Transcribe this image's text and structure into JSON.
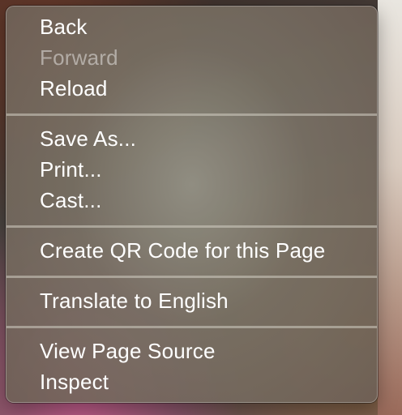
{
  "menu": {
    "groups": [
      {
        "items": [
          {
            "label": "Back",
            "enabled": true
          },
          {
            "label": "Forward",
            "enabled": false
          },
          {
            "label": "Reload",
            "enabled": true
          }
        ]
      },
      {
        "items": [
          {
            "label": "Save As...",
            "enabled": true
          },
          {
            "label": "Print...",
            "enabled": true
          },
          {
            "label": "Cast...",
            "enabled": true
          }
        ]
      },
      {
        "items": [
          {
            "label": "Create QR Code for this Page",
            "enabled": true
          }
        ]
      },
      {
        "items": [
          {
            "label": "Translate to English",
            "enabled": true
          }
        ]
      },
      {
        "items": [
          {
            "label": "View Page Source",
            "enabled": true
          },
          {
            "label": "Inspect",
            "enabled": true
          }
        ]
      }
    ]
  }
}
